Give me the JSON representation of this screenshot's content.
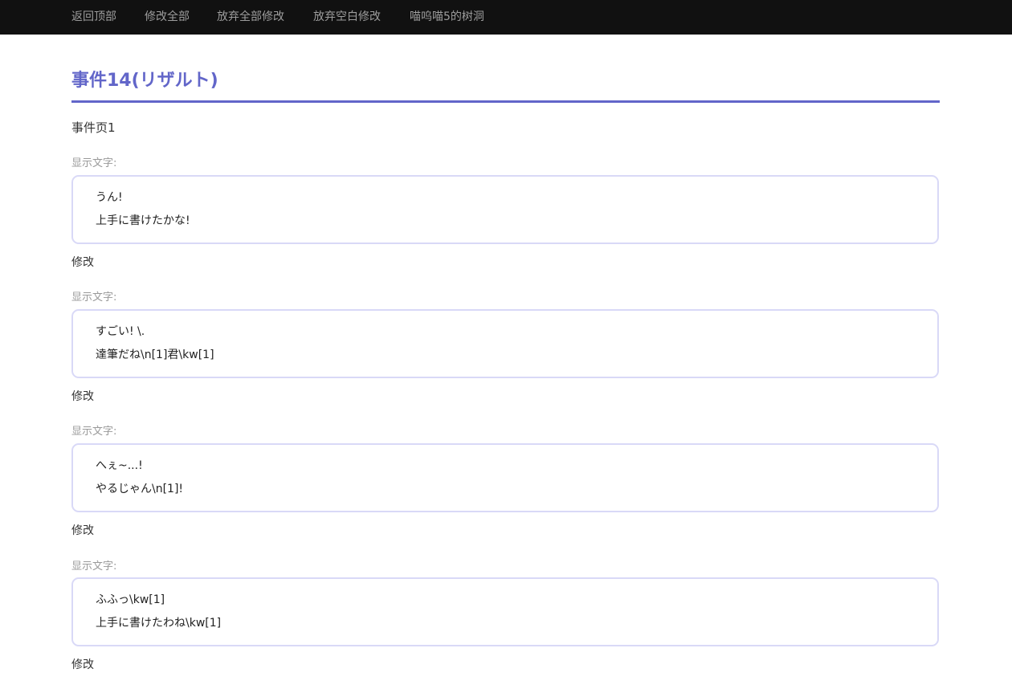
{
  "nav": {
    "items": [
      {
        "label": "返回顶部"
      },
      {
        "label": "修改全部"
      },
      {
        "label": "放弃全部修改"
      },
      {
        "label": "放弃空白修改"
      },
      {
        "label": "喵呜喵5的树洞"
      }
    ]
  },
  "page": {
    "title": "事件14(リザルト)",
    "subtitle": "事件页1"
  },
  "entries": [
    {
      "label": "显示文字:",
      "lines": [
        "うん!",
        "上手に書けたかな!"
      ],
      "edit_label": "修改"
    },
    {
      "label": "显示文字:",
      "lines": [
        "すごい! \\.",
        "達筆だね\\n[1]君\\kw[1]"
      ],
      "edit_label": "修改"
    },
    {
      "label": "显示文字:",
      "lines": [
        "へぇ~...!",
        "やるじゃん\\n[1]!"
      ],
      "edit_label": "修改"
    },
    {
      "label": "显示文字:",
      "lines": [
        "ふふっ\\kw[1]",
        "上手に書けたわね\\kw[1]"
      ],
      "edit_label": "修改"
    }
  ],
  "colors": {
    "nav_background": "#111111",
    "nav_text": "#9d9d9d",
    "accent": "#6266c9",
    "box_border": "#d9d9f7"
  }
}
